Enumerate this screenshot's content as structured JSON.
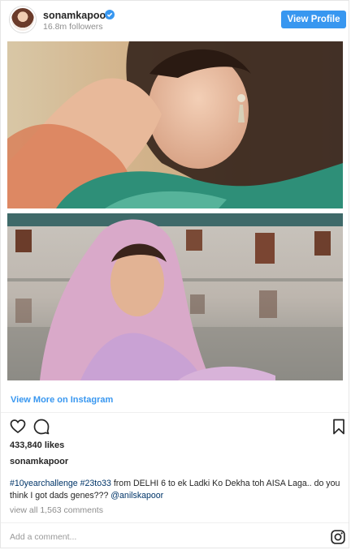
{
  "header": {
    "username": "sonamkapoor",
    "followers": "16.8m followers",
    "view_profile_label": "View Profile"
  },
  "post": {
    "view_more_label": "View More on Instagram",
    "likes": "433,840 likes",
    "caption_user": "sonamkapoor",
    "caption": {
      "hashtag1": "#10yearchallenge",
      "hashtag2": "#23to33",
      "text": " from DELHI 6 to ek Ladki Ko Dekha toh AISA Laga.. do you think I got dads genes??? ",
      "mention": "@anilskapoor"
    },
    "comments_link": "view all 1,563 comments",
    "comment_placeholder": "Add a comment..."
  },
  "colors": {
    "accent": "#3897f0",
    "link": "#003569",
    "muted": "#8e8e8e"
  },
  "icons": [
    "verified-icon",
    "heart-icon",
    "comment-icon",
    "bookmark-icon",
    "instagram-icon"
  ]
}
